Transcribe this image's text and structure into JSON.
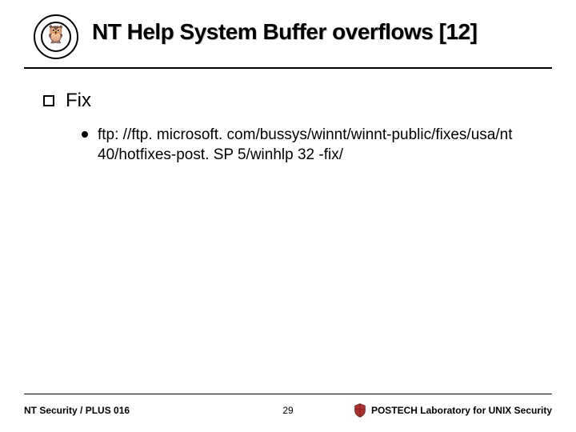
{
  "header": {
    "title": "NT Help System Buffer overflows [12]",
    "logo_name": "owl-seal-logo"
  },
  "body": {
    "lvl1": {
      "label": "Fix"
    },
    "lvl2": {
      "items": [
        {
          "text": "ftp: //ftp. microsoft. com/bussys/winnt/winnt-public/fixes/usa/nt 40/hotfixes-post. SP 5/winhlp 32 -fix/"
        }
      ]
    }
  },
  "footer": {
    "left": "NT Security / PLUS 016",
    "page": "29",
    "right": "POSTECH Laboratory for UNIX Security",
    "shield_name": "postech-shield-icon"
  }
}
